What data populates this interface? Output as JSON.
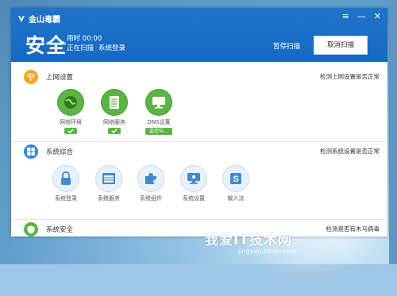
{
  "app": {
    "brand": "金山毒霸",
    "window_controls": [
      "≡",
      "—",
      "✕"
    ]
  },
  "header": {
    "status": "安全",
    "elapsed_label": "用时 00:00",
    "scan_progress": "正在扫描",
    "current_item": "系统登录",
    "pause_label": "暂停扫描",
    "cancel_label": "取消扫描"
  },
  "sections": [
    {
      "title": "上网设置",
      "status": "检测上网设置是否正常",
      "icon": "wifi-icon",
      "color": "#f5a623",
      "items": [
        {
          "label": "网络环境",
          "icon": "globe-icon",
          "state": "done"
        },
        {
          "label": "网络服务",
          "icon": "document-icon",
          "state": "done"
        },
        {
          "label": "DNS设置",
          "icon": "monitor-icon",
          "state": "scanning",
          "badge": "监控中..."
        }
      ]
    },
    {
      "title": "系统综合",
      "status": "检测系统设置是否正常",
      "icon": "windows-icon",
      "color": "#2e8ad8",
      "items": [
        {
          "label": "系统登录",
          "icon": "lock-icon",
          "state": "pending"
        },
        {
          "label": "系统服务",
          "icon": "window-icon",
          "state": "pending"
        },
        {
          "label": "系统组件",
          "icon": "puzzle-icon",
          "state": "pending"
        },
        {
          "label": "系统设置",
          "icon": "display-settings-icon",
          "state": "pending"
        },
        {
          "label": "输入法",
          "icon": "input-s-icon",
          "state": "pending"
        }
      ]
    },
    {
      "title": "系统安全",
      "status": "检测是否有木马病毒",
      "icon": "shield-icon",
      "color": "#5cb445",
      "items": []
    }
  ],
  "watermark": {
    "text": "我爱IT技术网",
    "sub": "jingyan.baidu.com"
  }
}
